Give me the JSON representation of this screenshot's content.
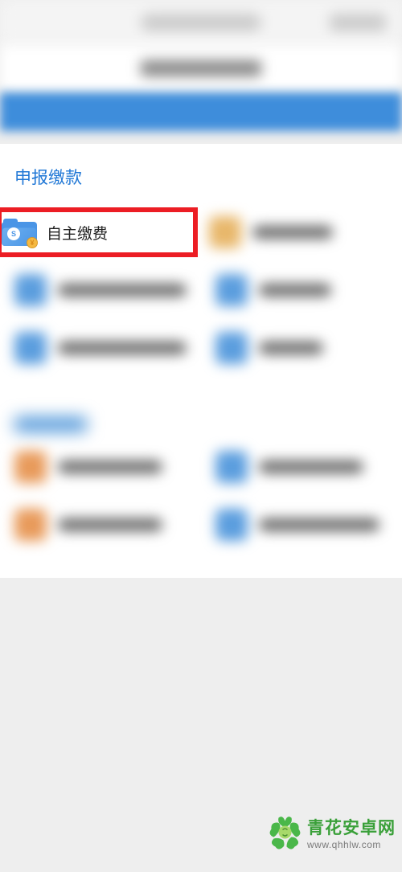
{
  "section": {
    "title": "申报缴款",
    "highlighted_item": {
      "label": "自主缴费",
      "icon": "payment-folder-icon"
    }
  },
  "watermark": {
    "name": "青花安卓网",
    "url": "www.qhhlw.com"
  },
  "colors": {
    "accent": "#2178d6",
    "highlight_border": "#ec1d24",
    "brand_green": "#3aa039"
  }
}
